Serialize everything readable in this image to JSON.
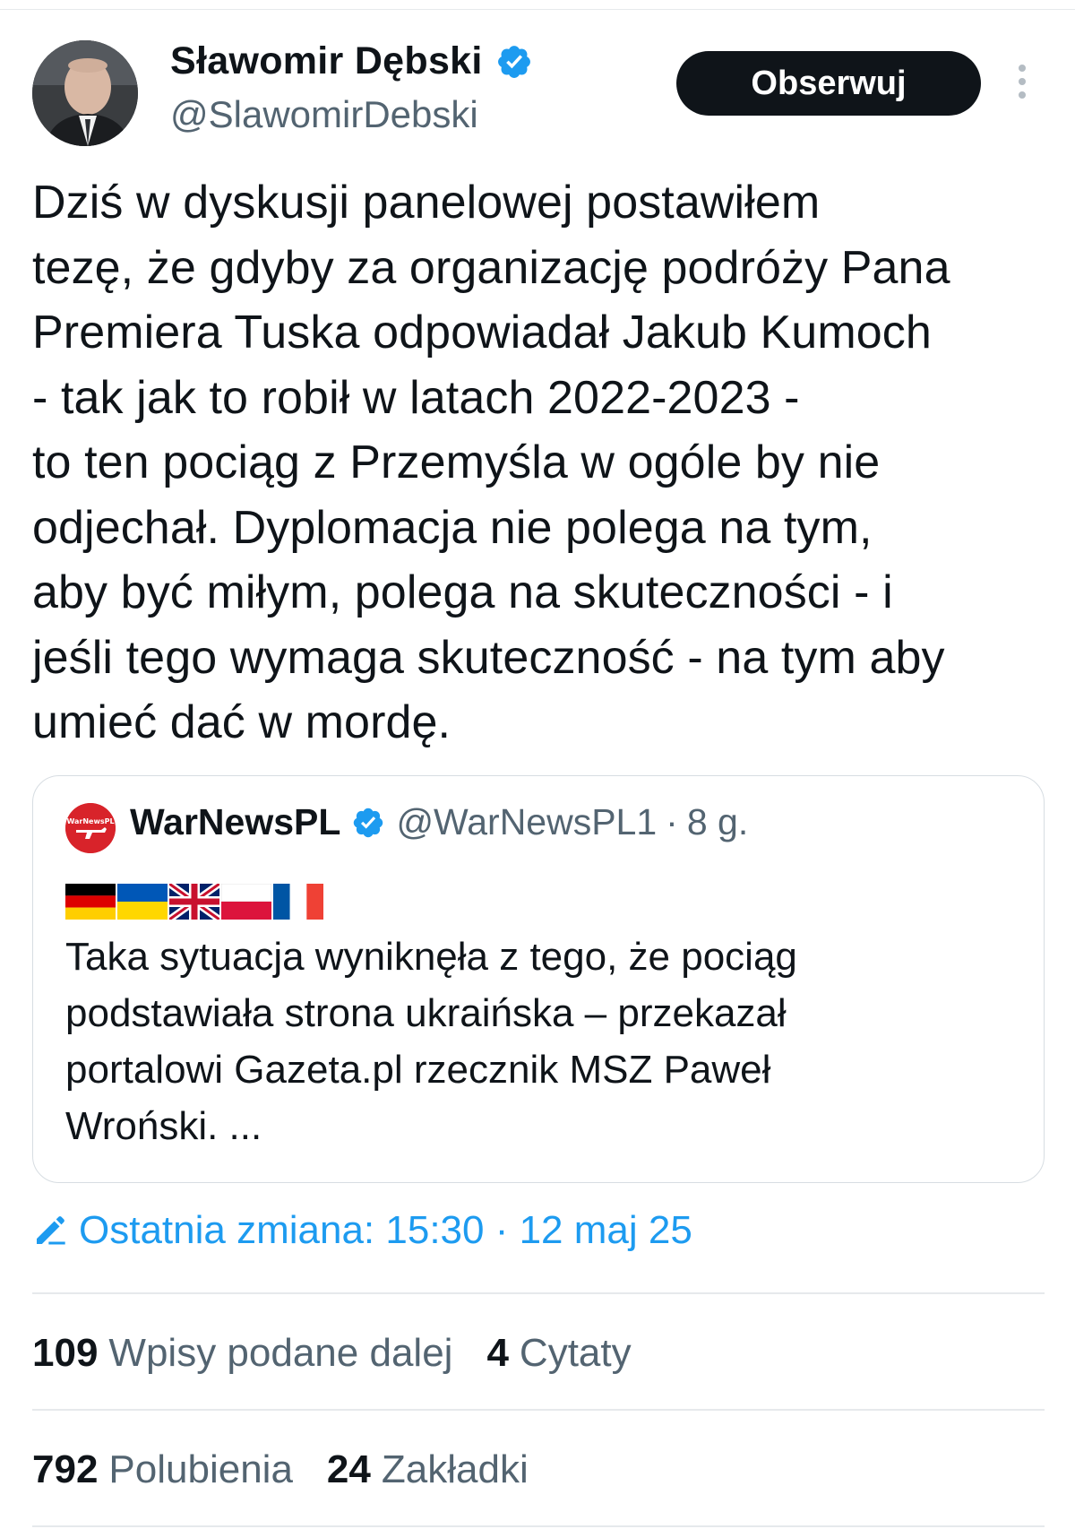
{
  "author": {
    "name": "Sławomir Dębski",
    "handle": "@SlawomirDebski",
    "avatar_icon": "profile-photo",
    "verified_color": "#1d9bf0"
  },
  "follow_button": {
    "label": "Obserwuj"
  },
  "more_menu": {
    "icon": "more-vertical-icon"
  },
  "tweet": {
    "text": "Dziś w dyskusji panelowej postawiłem\ntezę, że gdyby za organizację podróży Pana\nPremiera Tuska odpowiadał Jakub Kumoch\n- tak jak to robił w latach 2022-2023 -\nto ten pociąg z Przemyśla w ogóle by nie\nodjechał. Dyplomacja nie polega na tym,\naby być miłym, polega na skuteczności - i\njeśli tego wymaga skuteczność - na tym aby\numieć dać w mordę."
  },
  "quote": {
    "name": "WarNewsPL",
    "handle": "@WarNewsPL1",
    "separator": "·",
    "time": "8 g.",
    "avatar_text": "WarNewsPL",
    "flags": [
      "germany-flag",
      "ukraine-flag",
      "uk-flag",
      "poland-flag",
      "france-flag"
    ],
    "text": "Taka sytuacja wyniknęła z tego, że pociąg\npodstawiała strona ukraińska – przekazał\nportalowi Gazeta.pl rzecznik MSZ Paweł\nWroński. ..."
  },
  "edited": {
    "label": "Ostatnia zmiana: 15:30 · 12 maj 25",
    "icon": "pencil-icon",
    "color": "#1d9bf0"
  },
  "stats": {
    "reposts": {
      "count": "109",
      "label": "Wpisy podane dalej"
    },
    "quotes": {
      "count": "4",
      "label": "Cytaty"
    },
    "likes": {
      "count": "792",
      "label": "Polubienia"
    },
    "bookmarks": {
      "count": "24",
      "label": "Zakładki"
    }
  }
}
